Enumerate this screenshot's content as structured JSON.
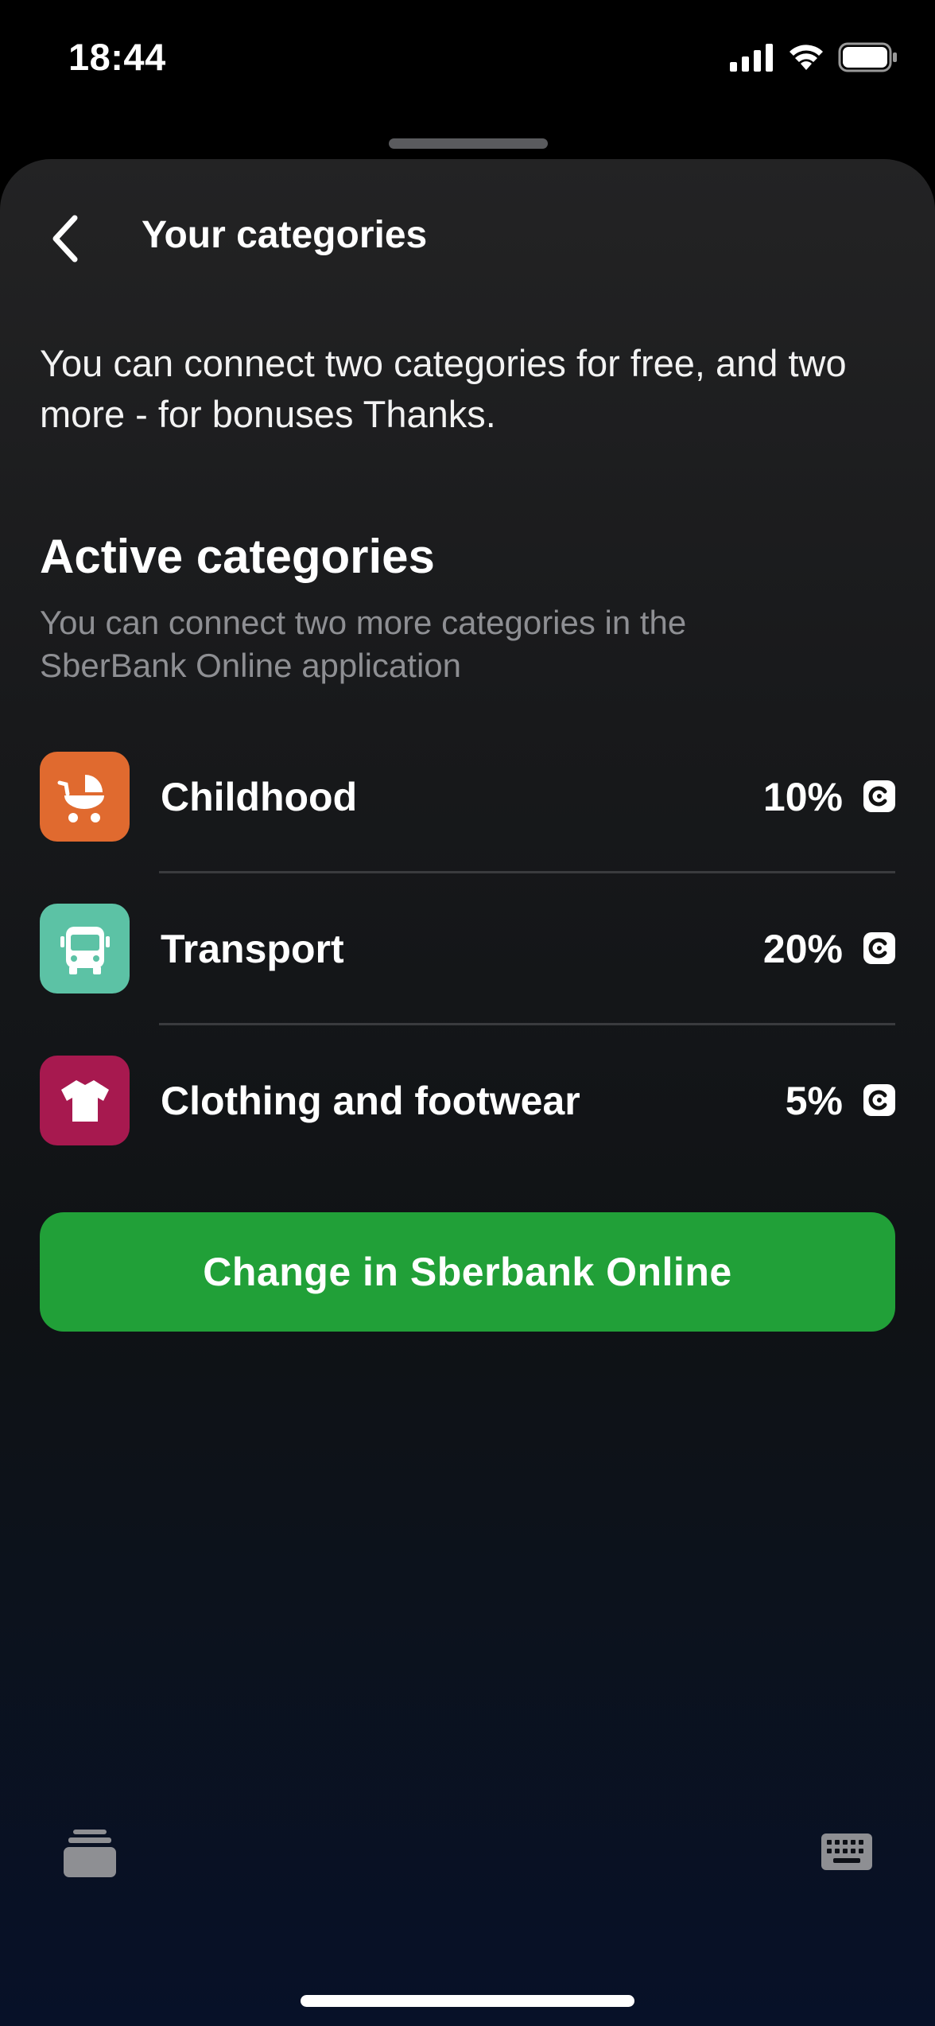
{
  "status_bar": {
    "time": "18:44",
    "icons": [
      "signal-icon",
      "wifi-icon",
      "battery-icon"
    ]
  },
  "header": {
    "back_icon": "chevron-left-icon",
    "title": "Your categories"
  },
  "intro": {
    "text": "You can connect two categories for free, and two more - for bonuses Thanks."
  },
  "active_section": {
    "title": "Active categories",
    "subtitle": "You can connect two more categories in the SberBank Online application"
  },
  "categories": [
    {
      "name": "Childhood",
      "percent": "10%",
      "icon": "stroller-icon",
      "color": "#e06a2f"
    },
    {
      "name": "Transport",
      "percent": "20%",
      "icon": "bus-icon",
      "color": "#5cc2a5"
    },
    {
      "name": "Clothing and footwear",
      "percent": "5%",
      "icon": "tshirt-icon",
      "color": "#a7194f"
    }
  ],
  "action": {
    "label": "Change in Sberbank Online"
  },
  "toolbar": {
    "left_icon": "card-stack-icon",
    "right_icon": "keyboard-icon"
  },
  "colors": {
    "accent_green": "#21a038",
    "childhood": "#e06a2f",
    "transport": "#5cc2a5",
    "clothing": "#a7194f"
  }
}
